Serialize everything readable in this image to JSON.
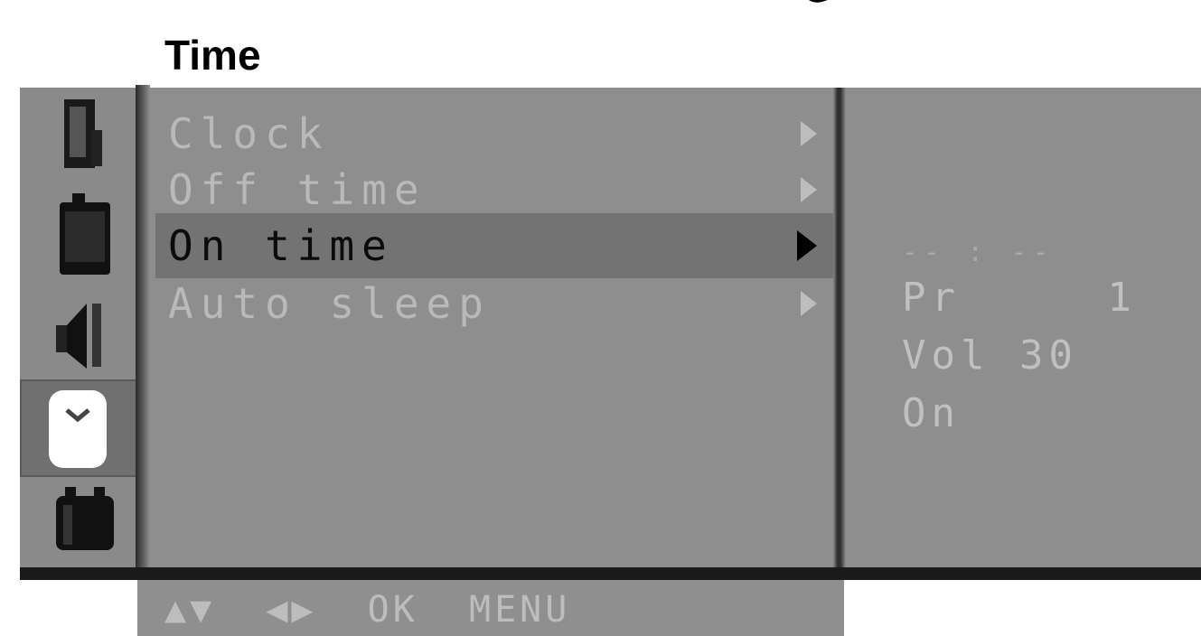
{
  "page": {
    "title": "Time"
  },
  "menu": {
    "items": [
      {
        "label": "Clock",
        "highlighted": false
      },
      {
        "label": "Off time",
        "highlighted": false
      },
      {
        "label": "On time",
        "highlighted": true
      },
      {
        "label": "Auto sleep",
        "highlighted": false
      }
    ]
  },
  "sidebar": {
    "icons": [
      {
        "name": "picture-icon"
      },
      {
        "name": "sound-icon"
      },
      {
        "name": "speaker-icon"
      },
      {
        "name": "time-icon",
        "selected": true
      },
      {
        "name": "special-icon"
      }
    ]
  },
  "info_panel": {
    "time": "-- : --",
    "programme": "Pr     1",
    "volume": "Vol 30",
    "status": "On"
  },
  "footer": {
    "hint": "▲▼  ◀▶  OK  MENU"
  },
  "colors": {
    "osd_background": "#8e8e8e",
    "highlight": "#737373",
    "text_dim": "#b9b9b9"
  }
}
